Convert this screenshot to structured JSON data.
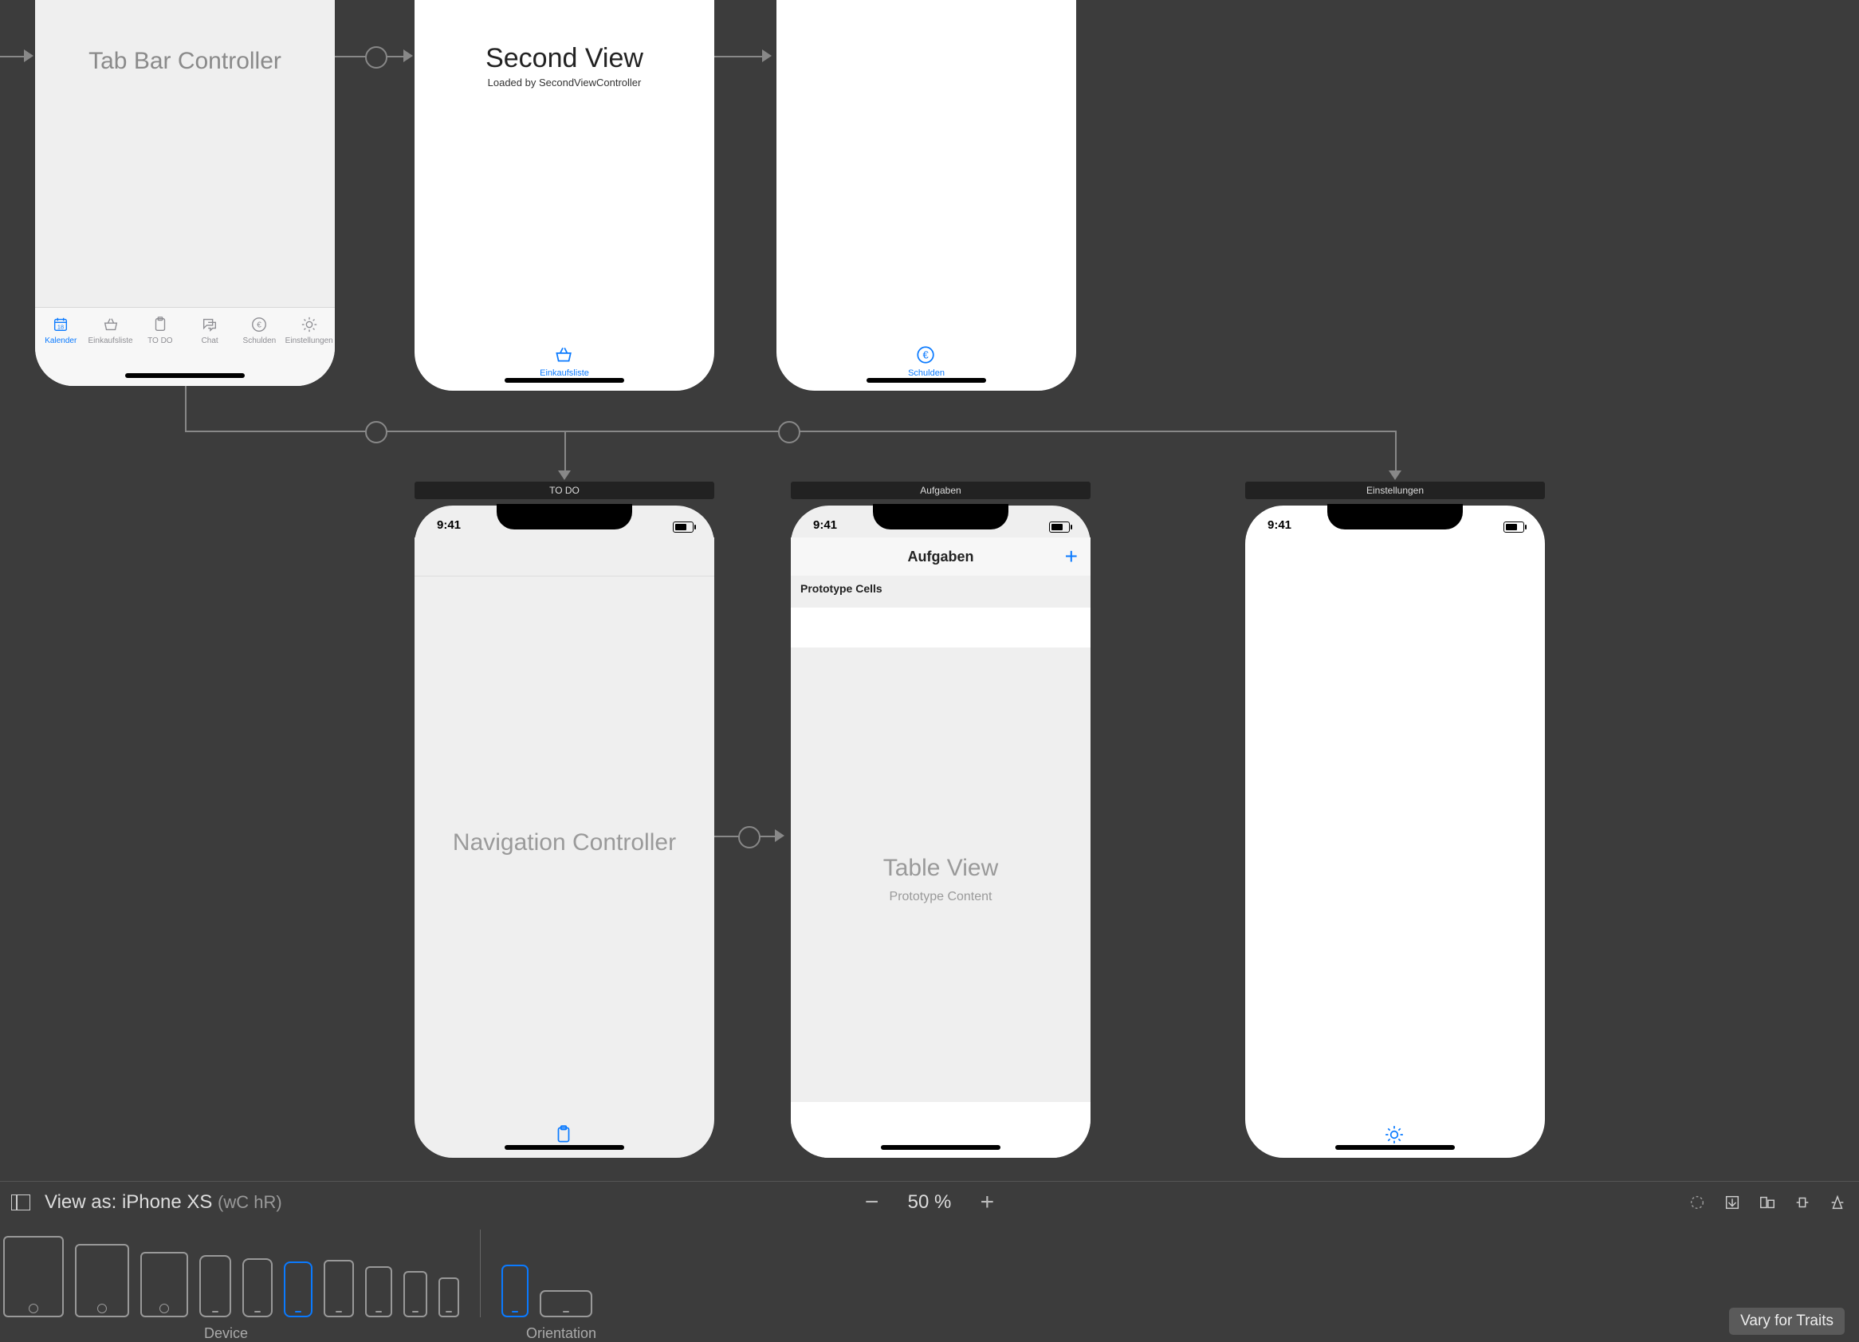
{
  "scenes": {
    "tabBarController": {
      "title": "Tab Bar Controller"
    },
    "secondView": {
      "title": "Second View",
      "subtitle": "Loaded by SecondViewController",
      "tabLabel": "Einkaufsliste"
    },
    "schulden": {
      "tabLabel": "Schulden"
    },
    "todo": {
      "sceneLabel": "TO DO",
      "centerText": "Navigation Controller",
      "statusTime": "9:41"
    },
    "aufgaben": {
      "sceneLabel": "Aufgaben",
      "navTitle": "Aufgaben",
      "protoHeader": "Prototype Cells",
      "tableTitle": "Table View",
      "tableSubtitle": "Prototype Content",
      "statusTime": "9:41"
    },
    "einstellungen": {
      "sceneLabel": "Einstellungen",
      "statusTime": "9:41"
    }
  },
  "tabItems": [
    {
      "label": "Kalender",
      "icon": "calendar"
    },
    {
      "label": "Einkaufsliste",
      "icon": "basket"
    },
    {
      "label": "TO DO",
      "icon": "clipboard"
    },
    {
      "label": "Chat",
      "icon": "chat"
    },
    {
      "label": "Schulden",
      "icon": "euro"
    },
    {
      "label": "Einstellungen",
      "icon": "gear"
    }
  ],
  "bottomBar": {
    "viewAsPrefix": "View as: ",
    "viewAsDevice": "iPhone XS ",
    "viewAsTraits": "(wC hR)",
    "zoom": "50 %",
    "deviceLabel": "Device",
    "orientationLabel": "Orientation",
    "varyForTraits": "Vary for Traits"
  }
}
